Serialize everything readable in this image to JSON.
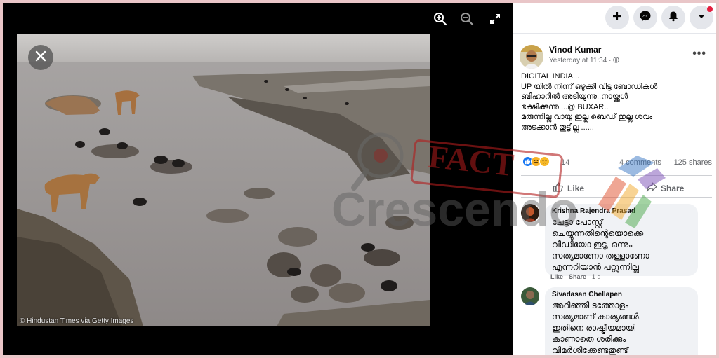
{
  "viewer": {
    "photo_credit": "© Hindustan Times via Getty Images",
    "icons": {
      "zoom_in": "zoom-in-icon",
      "zoom_out": "zoom-out-icon",
      "fullscreen": "expand-icon",
      "close": "close-icon"
    }
  },
  "topbar": {
    "buttons": [
      "create-plus-icon",
      "messenger-icon",
      "notifications-bell-icon",
      "account-chevron-icon"
    ]
  },
  "post": {
    "author": "Vinod Kumar",
    "time": "Yesterday at 11:34 ·",
    "body_lines": [
      "DIGITAL INDIA...",
      "UP യിൽ നിന്ന് ഒഴുക്കി വിട്ട ബോഡികൾ",
      "ബിഹാറിൽ അടിയുന്നു..നായ്ക്കൾ",
      "ഭക്ഷിക്കുന്നു ...@ BUXAR..",
      "മരുന്നില്ല വായു ഇല്ല ബെഡ് ഇല്ല ശവം",
      "അടക്കാൻ തുട്ടില്ല ......"
    ],
    "reaction_count": "14",
    "comments_count": "4 comments",
    "shares_count": "125 shares",
    "like_label": "Like",
    "share_label": "Share"
  },
  "comments": [
    {
      "name": "Krishna Rajendra Prasad",
      "lines": [
        "ചേട്ടാ പോസ്റ്റ്",
        "ചെയ്യുന്നതിന്റെയൊക്കെ",
        "വീഡിയോ ഇടൂ, ഒന്നും",
        "സത്യമാണോ തള്ളാണോ",
        "എന്നറിയാൻ പറ്റുന്നില്ല"
      ],
      "like": "Like",
      "share": "Share",
      "age": "1 d"
    },
    {
      "name": "Sivadasan Chellapen",
      "lines": [
        "അറിഞ്ഞി ടത്തോളം",
        "സത്യമാണ് കാര്യങ്ങൾ.",
        "ഇതിനെ രാഷ്ട്രീയമായി",
        "കാണാതെ ശരിക്കും",
        "വിമർശിക്കേണ്ടതുണ്ട്"
      ]
    }
  ],
  "watermark": {
    "word1": "FACT",
    "word2": "Crescendo"
  },
  "colors": {
    "bg_border": "#e9c6c8",
    "fb_bg": "#f0f2f5",
    "like_blue": "#1877f2",
    "haha_yellow": "#f7b125",
    "sad_yellow": "#f7b928",
    "notif_red": "#e41e3f"
  }
}
